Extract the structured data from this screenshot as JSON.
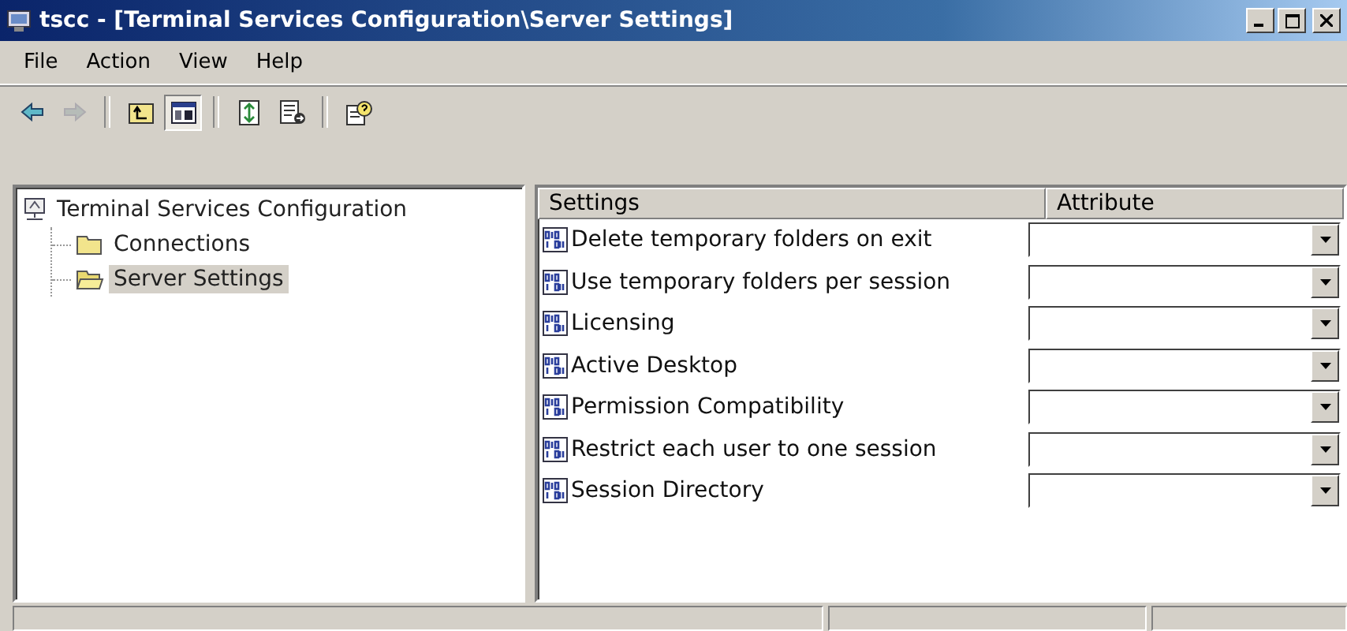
{
  "window": {
    "title": "tscc - [Terminal Services Configuration\\Server Settings]"
  },
  "menu": [
    "File",
    "Action",
    "View",
    "Help"
  ],
  "toolbar": [
    {
      "kind": "back",
      "disabled": false
    },
    {
      "kind": "forward",
      "disabled": true
    },
    {
      "kind": "sep"
    },
    {
      "kind": "up",
      "disabled": false
    },
    {
      "kind": "tree",
      "disabled": false,
      "on": true
    },
    {
      "kind": "sep"
    },
    {
      "kind": "refresh",
      "disabled": false
    },
    {
      "kind": "export",
      "disabled": false
    },
    {
      "kind": "sep"
    },
    {
      "kind": "help",
      "disabled": false
    }
  ],
  "tree": {
    "label": "Terminal Services Configuration",
    "selected": false,
    "children": [
      {
        "label": "Connections",
        "selected": false
      },
      {
        "label": "Server Settings",
        "selected": true
      }
    ]
  },
  "table": {
    "columns": [
      "Settings",
      "Attribute"
    ],
    "rows": [
      {
        "name": "Delete temporary folders on exit"
      },
      {
        "name": "Use temporary folders per session"
      },
      {
        "name": "Licensing"
      },
      {
        "name": "Active Desktop"
      },
      {
        "name": "Permission Compatibility"
      },
      {
        "name": "Restrict each user to one session"
      },
      {
        "name": "Session Directory"
      }
    ]
  }
}
